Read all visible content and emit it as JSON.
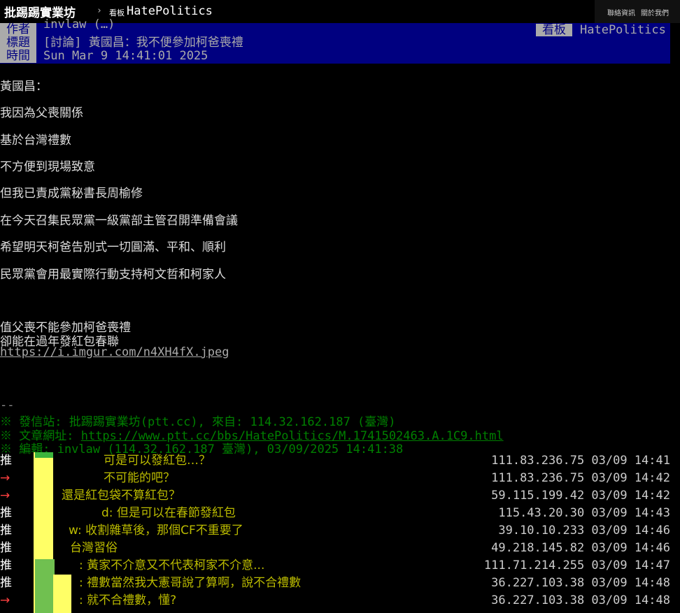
{
  "topbar": {
    "board_name": "批踢踢實業坊",
    "separator": "›",
    "board_tag": "看板",
    "board_link": "HatePolitics",
    "links": [
      "聯絡資訊",
      "關於我們"
    ]
  },
  "header": {
    "author_label": "作者",
    "author_value": "invlaw (…)",
    "board_label": "看板",
    "board_value": "HatePolitics",
    "title_label": "標題",
    "title_value": "[討論] 黃國昌：我不便參加柯爸喪禮",
    "time_label": "時間",
    "time_value": "Sun Mar  9 14:41:01 2025"
  },
  "content": {
    "lines": [
      "黃國昌：",
      "我因為父喪關係",
      "基於台灣禮數",
      "不方便到現場致意",
      "但我已責成黨秘書長周榆修",
      "在今天召集民眾黨一級黨部主管召開準備會議",
      "希望明天柯爸告別式一切圓滿、平和、順利",
      "民眾黨會用最實際行動支持柯文哲和柯家人"
    ],
    "comment_lines": [
      "值父喪不能參加柯爸喪禮",
      "卻能在過年發紅包春聯"
    ],
    "image_link": "https://i.imgur.com/n4XH4fX.jpeg"
  },
  "signature": {
    "dashes": "--",
    "site_prefix": "※ 發信站: 批踢踢實業坊(ptt.cc), 來自: 114.32.162.187 (臺灣)",
    "url_prefix": "※ 文章網址: ",
    "url": "https://www.ptt.cc/bbs/HatePolitics/M.1741502463.A.1C9.html",
    "edit": "※ 編輯: invlaw (114.32.162.187 臺灣), 03/09/2025 14:41:38"
  },
  "pushes": [
    {
      "tag": "推",
      "text": "可是可以發紅包…？",
      "ipdate": "111.83.236.75 03/09 14:41"
    },
    {
      "tag": "→",
      "text": "不可能的吧？",
      "ipdate": "111.83.236.75 03/09 14:42"
    },
    {
      "tag": "→",
      "text": "還是紅包袋不算紅包？",
      "ipdate": "59.115.199.42 03/09 14:42"
    },
    {
      "tag": "推",
      "text": "d: 但是可以在春節發紅包",
      "ipdate": "115.43.20.30 03/09 14:43"
    },
    {
      "tag": "推",
      "text": "w: 收割雜草後，那個CF不重要了",
      "ipdate": "39.10.10.233 03/09 14:46"
    },
    {
      "tag": "推",
      "text": "台灣習俗",
      "ipdate": "49.218.145.82 03/09 14:46"
    },
    {
      "tag": "推",
      "text": ": 黃家不介意又不代表柯家不介意...",
      "ipdate": "111.71.214.255 03/09 14:47"
    },
    {
      "tag": "推",
      "text": ": 禮數當然我大憲哥說了算啊，說不合禮數",
      "ipdate": "36.227.103.38 03/09 14:48"
    },
    {
      "tag": "→",
      "text": ": 就不合禮數，懂?",
      "ipdate": "36.227.103.38 03/09 14:48"
    }
  ]
}
